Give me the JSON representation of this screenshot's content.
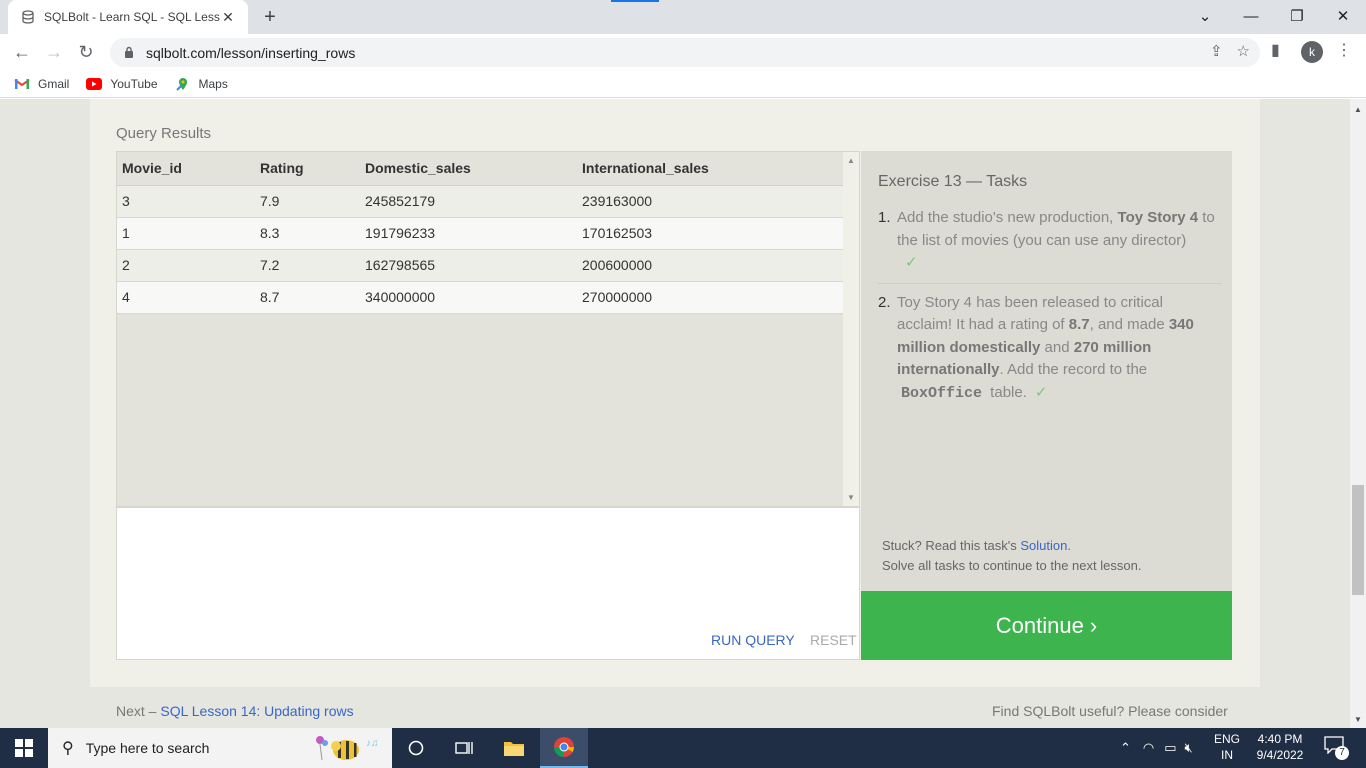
{
  "browser": {
    "tab_title": "SQLBolt - Learn SQL - SQL Lesso",
    "tab_close": "✕",
    "new_tab": "+",
    "url": "sqlbolt.com/lesson/inserting_rows",
    "profile_initial": "k",
    "bookmarks": [
      {
        "label": "Gmail",
        "icon": "gmail-icon"
      },
      {
        "label": "YouTube",
        "icon": "youtube-icon"
      },
      {
        "label": "Maps",
        "icon": "maps-icon"
      }
    ]
  },
  "query_results": {
    "title": "Query Results",
    "columns": [
      "Movie_id",
      "Rating",
      "Domestic_sales",
      "International_sales"
    ],
    "rows": [
      [
        "3",
        "7.9",
        "245852179",
        "239163000"
      ],
      [
        "1",
        "8.3",
        "191796233",
        "170162503"
      ],
      [
        "2",
        "7.2",
        "162798565",
        "200600000"
      ],
      [
        "4",
        "8.7",
        "340000000",
        "270000000"
      ]
    ]
  },
  "editor": {
    "run_label": "RUN QUERY",
    "reset_label": "RESET"
  },
  "exercise": {
    "title": "Exercise 13 — Tasks",
    "task1": {
      "num": "1.",
      "pre": "Add the studio's new production, ",
      "bold": "Toy Story 4",
      "post": " to the list of movies (you can use any director)",
      "check": "✓"
    },
    "task2": {
      "num": "2.",
      "t1": "Toy Story 4 has been released to critical acclaim! It had a rating of ",
      "b1": "8.7",
      "t2": ", and made ",
      "b2": "340 million domestically",
      "t3": " and ",
      "b3": "270 million internationally",
      "t4": ". Add the record to the ",
      "code": "BoxOffice",
      "t5": " table.",
      "check": "✓"
    },
    "stuck_pre": "Stuck? Read this task's ",
    "solution_link": "Solution",
    "stuck_post": ".",
    "solve_all": "Solve all tasks to continue to the next lesson.",
    "continue_label": "Continue ›"
  },
  "footer": {
    "next_prefix": "Next – ",
    "next_link": "SQL Lesson 14: Updating rows",
    "useful": "Find SQLBolt useful? Please consider"
  },
  "taskbar": {
    "search_placeholder": "Type here to search",
    "lang_line1": "ENG",
    "lang_line2": "IN",
    "time": "4:40 PM",
    "date": "9/4/2022",
    "notifications": "7"
  },
  "colors": {
    "accent_green": "#3db44d",
    "link_blue": "#3a66c5",
    "taskbar": "#1f2e45"
  }
}
